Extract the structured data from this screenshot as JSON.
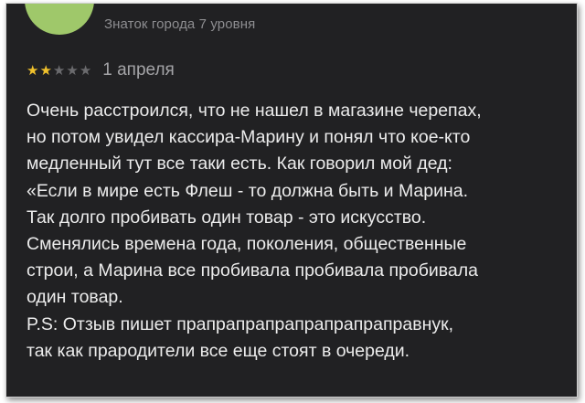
{
  "author": {
    "level": "Знаток города 7 уровня"
  },
  "review": {
    "rating": 2,
    "rating_max": 5,
    "date": "1 апреля",
    "lines": [
      "Очень расстроился, что не нашел в магазине черепах,",
      "но потом увидел кассира-Марину и понял что кое-кто",
      "медленный тут все таки есть. Как говорил мой дед:",
      "«Если в мире есть Флеш - то должна быть и Марина.",
      "Так долго пробивать один товар - это искусство.",
      "Сменялись времена года, поколения, общественные",
      "строи, а Марина все пробивала пробивала пробивала",
      "один товар.",
      "P.S: Отзыв пишет прапрапрапрапрапрапраправнук,",
      "так как прародители все еще стоят в очереди."
    ]
  },
  "colors": {
    "background": "#212123",
    "star_filled": "#f0c12c",
    "star_empty": "#6a6a6d",
    "avatar": "#9fc86a"
  },
  "icons": {
    "avatar": "user-avatar-icon",
    "star": "star-icon"
  }
}
